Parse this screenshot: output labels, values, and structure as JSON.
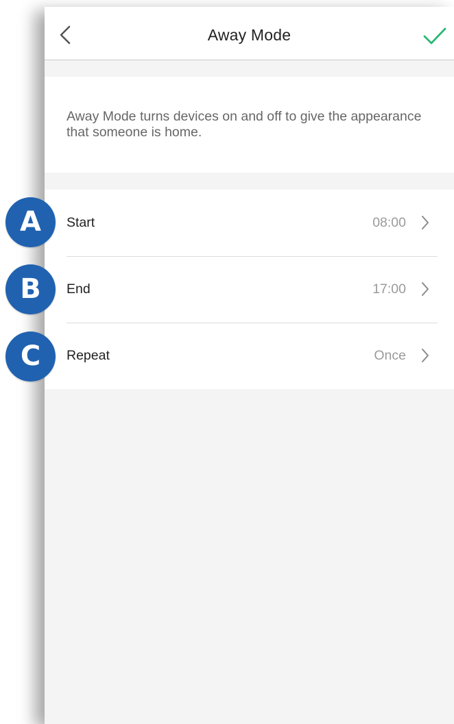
{
  "header": {
    "title": "Away Mode",
    "back_icon": "chevron-left-icon",
    "confirm_icon": "checkmark-icon",
    "confirm_color": "#2bb673"
  },
  "description": {
    "text": "Away Mode turns devices on and off to give the appearance that someone is home."
  },
  "settings": [
    {
      "label": "Start",
      "value": "08:00",
      "marker": "A"
    },
    {
      "label": "End",
      "value": "17:00",
      "marker": "B"
    },
    {
      "label": "Repeat",
      "value": "Once",
      "marker": "C"
    }
  ],
  "colors": {
    "marker_fill": "#2062b0",
    "background": "#f4f4f4",
    "card": "#ffffff"
  }
}
